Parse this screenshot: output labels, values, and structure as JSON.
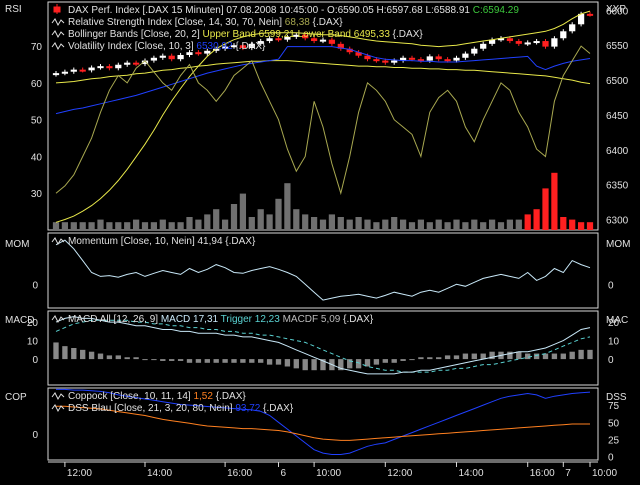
{
  "colors": {
    "background": "#000000",
    "frame": "#d8d8d8",
    "text": "#e0e0e0",
    "price_white": "#ffffff",
    "price_red": "#ff2020",
    "bollinger": "#e8e84a",
    "volatility": "#2040ff",
    "rsi": "#a8a850",
    "volume": "#707070",
    "momentum": "#c8e8f8",
    "macd": "#c8e8f8",
    "trigger": "#5ad2d2",
    "histogram": "#888888",
    "coppock": "#ff8020",
    "dss": "#2040ff",
    "last_price": "#3cc83c"
  },
  "chart_data": [
    {
      "type": "candlestick",
      "panel": "price",
      "left_label": "RSI",
      "right_label": "XXP",
      "left_axis_ticks": [
        30,
        40,
        50,
        60,
        70
      ],
      "right_axis_ticks": [
        6300,
        6350,
        6400,
        6450,
        6500,
        6550,
        6600
      ],
      "ylim_price": [
        6285,
        6612
      ],
      "ylim_rsi": [
        20,
        82
      ],
      "legend": [
        {
          "icon": "candle",
          "text": "DAX Perf. Index [.DAX  15 Minuten] 07.08.2008 10:45:00 - O:6590.05 H:6597.68 L:6588.91 ",
          "value": "C:6594.29",
          "value_color": "#3cc83c"
        },
        {
          "icon": "line",
          "text": "Relative Strength Index [Close, 14, 30, 70, Nein] ",
          "value": "68,38",
          "value_color": "#a8a850",
          "suffix": " {.DAX}"
        },
        {
          "icon": "line",
          "text": "Bollinger Bands [Close, 20, 2] ",
          "value": "Upper Band 6599,21 Lower Band 6495,33",
          "value_color": "#e8e84a",
          "suffix": " {.DAX}"
        },
        {
          "icon": "line",
          "text": "Volatility Index [Close, 10, 3] ",
          "value": "6530,92",
          "value_color": "#2040ff",
          "suffix": " {.DAX}"
        }
      ],
      "series": [
        {
          "name": "Close",
          "values": [
            6510,
            6512,
            6515,
            6514,
            6518,
            6520,
            6517,
            6522,
            6525,
            6523,
            6528,
            6532,
            6535,
            6530,
            6536,
            6540,
            6538,
            6542,
            6545,
            6548,
            6550,
            6546,
            6552,
            6556,
            6560,
            6558,
            6562,
            6565,
            6560,
            6556,
            6558,
            6552,
            6545,
            6540,
            6535,
            6530,
            6528,
            6525,
            6528,
            6532,
            6530,
            6528,
            6534,
            6530,
            6528,
            6532,
            6538,
            6545,
            6552,
            6558,
            6560,
            6556,
            6552,
            6554,
            6556,
            6548,
            6560,
            6570,
            6580,
            6595,
            6594
          ]
        },
        {
          "name": "Upper Band",
          "values": [
            6296,
            6300,
            6305,
            6312,
            6320,
            6330,
            6342,
            6356,
            6372,
            6390,
            6408,
            6428,
            6450,
            6470,
            6488,
            6505,
            6520,
            6534,
            6545,
            6552,
            6558,
            6562,
            6565,
            6567,
            6568,
            6568,
            6568,
            6568,
            6567,
            6566,
            6565,
            6565,
            6564,
            6562,
            6560,
            6558,
            6556,
            6555,
            6554,
            6553,
            6552,
            6550,
            6549,
            6548,
            6549,
            6550,
            6552,
            6554,
            6556,
            6558,
            6560,
            6562,
            6564,
            6566,
            6568,
            6570,
            6574,
            6580,
            6588,
            6595,
            6599
          ]
        },
        {
          "name": "Lower Band",
          "values": [
            6496,
            6497,
            6498,
            6500,
            6502,
            6503,
            6505,
            6506,
            6507,
            6509,
            6510,
            6512,
            6514,
            6515,
            6517,
            6518,
            6520,
            6521,
            6523,
            6524,
            6525,
            6526,
            6527,
            6527,
            6528,
            6528,
            6528,
            6527,
            6526,
            6525,
            6524,
            6523,
            6522,
            6521,
            6520,
            6520,
            6519,
            6519,
            6518,
            6518,
            6517,
            6517,
            6516,
            6516,
            6515,
            6515,
            6514,
            6514,
            6513,
            6512,
            6511,
            6510,
            6509,
            6508,
            6507,
            6506,
            6504,
            6502,
            6500,
            6497,
            6495
          ]
        },
        {
          "name": "Volatility Index",
          "values": [
            6452,
            6455,
            6458,
            6460,
            6463,
            6466,
            6469,
            6472,
            6475,
            6478,
            6482,
            6486,
            6490,
            6494,
            6498,
            6502,
            6506,
            6510,
            6513,
            6516,
            6519,
            6522,
            6524,
            6526,
            6528,
            6530,
            6548,
            6548,
            6548,
            6548,
            6548,
            6548,
            6546,
            6544,
            6540,
            6536,
            6532,
            6530,
            6529,
            6528,
            6528,
            6527,
            6527,
            6526,
            6526,
            6526,
            6527,
            6528,
            6529,
            6530,
            6531,
            6532,
            6533,
            6534,
            6520,
            6515,
            6520,
            6524,
            6527,
            6529,
            6531
          ]
        },
        {
          "name": "RSI",
          "values": [
            30,
            32,
            35,
            40,
            45,
            52,
            58,
            62,
            60,
            64,
            66,
            63,
            60,
            58,
            62,
            65,
            60,
            58,
            55,
            58,
            62,
            64,
            66,
            60,
            55,
            50,
            42,
            36,
            40,
            55,
            48,
            38,
            30,
            40,
            52,
            60,
            58,
            55,
            50,
            48,
            46,
            40,
            52,
            56,
            58,
            55,
            48,
            44,
            50,
            55,
            60,
            58,
            52,
            48,
            42,
            40,
            55,
            62,
            66,
            70,
            68
          ]
        },
        {
          "name": "Volume",
          "values": [
            3,
            3,
            3,
            3,
            3,
            4,
            3,
            3,
            3,
            4,
            3,
            3,
            4,
            3,
            3,
            5,
            4,
            6,
            8,
            4,
            10,
            14,
            5,
            8,
            6,
            12,
            18,
            8,
            6,
            5,
            4,
            6,
            5,
            4,
            5,
            4,
            3,
            4,
            5,
            4,
            3,
            4,
            3,
            4,
            3,
            4,
            3,
            4,
            3,
            4,
            3,
            4,
            4,
            6,
            8,
            16,
            22,
            5,
            4,
            3,
            3
          ]
        }
      ]
    },
    {
      "type": "line",
      "panel": "momentum",
      "left_label": "MOM",
      "right_label": "MOM",
      "axis_ticks": [
        0
      ],
      "ylim": [
        -60,
        130
      ],
      "legend": [
        {
          "icon": "line",
          "text": "Momentum [Close, 10, Nein] 41,94 {.DAX}"
        }
      ],
      "series": [
        {
          "name": "Momentum",
          "values": [
            100,
            112,
            90,
            60,
            30,
            20,
            22,
            18,
            25,
            30,
            20,
            28,
            35,
            30,
            25,
            40,
            30,
            38,
            50,
            42,
            30,
            28,
            35,
            40,
            45,
            38,
            30,
            20,
            0,
            -20,
            -40,
            -35,
            -30,
            -28,
            -25,
            -30,
            -35,
            -28,
            -20,
            -25,
            -30,
            -20,
            -15,
            -20,
            -10,
            0,
            -5,
            5,
            15,
            20,
            25,
            20,
            15,
            30,
            10,
            20,
            40,
            30,
            60,
            50,
            42
          ]
        }
      ]
    },
    {
      "type": "line",
      "panel": "macd",
      "left_label": "MACD",
      "right_label": "MAC",
      "axis_ticks": [
        0,
        10,
        20
      ],
      "ylim": [
        -14,
        26
      ],
      "legend": [
        {
          "icon": "line",
          "text": "MACD All [12, 26, 9] ",
          "value": "MACD 17,31",
          "value_color": "#c8e8f8",
          "parts": [
            {
              "text": " Trigger 12,23",
              "color": "#5ad2d2"
            },
            {
              "text": " MACDF 5,09",
              "color": "#bbbbbb"
            }
          ],
          "suffix": " {.DAX}"
        }
      ],
      "series": [
        {
          "name": "MACD",
          "values": [
            20,
            22,
            23,
            22,
            22,
            21,
            20,
            20,
            19,
            18,
            18,
            17,
            16,
            16,
            15,
            15,
            14,
            14,
            14,
            13,
            13,
            12,
            12,
            11,
            10,
            9,
            7,
            5,
            3,
            1,
            -1,
            -3,
            -5,
            -6,
            -7,
            -8,
            -8,
            -8,
            -8,
            -7,
            -7,
            -6,
            -6,
            -5,
            -4,
            -3,
            -2,
            -1,
            0,
            1,
            2,
            3,
            4,
            4,
            5,
            6,
            8,
            10,
            13,
            16,
            17
          ]
        },
        {
          "name": "Trigger",
          "values": [
            15,
            17,
            19,
            20,
            21,
            21,
            21,
            21,
            21,
            20,
            20,
            19,
            19,
            18,
            18,
            17,
            17,
            16,
            16,
            15,
            15,
            14,
            14,
            13,
            13,
            12,
            11,
            10,
            9,
            7,
            5,
            3,
            1,
            -1,
            -2,
            -4,
            -5,
            -6,
            -6,
            -7,
            -7,
            -7,
            -7,
            -6,
            -6,
            -5,
            -5,
            -4,
            -3,
            -3,
            -2,
            -1,
            0,
            1,
            2,
            3,
            5,
            7,
            9,
            11,
            12
          ]
        },
        {
          "name": "MACDF",
          "values": [
            9,
            7,
            6,
            5,
            4,
            3,
            2,
            2,
            1,
            1,
            0,
            0,
            -1,
            -1,
            -1,
            -2,
            -2,
            -2,
            -2,
            -2,
            -2,
            -2,
            -2,
            -2,
            -3,
            -3,
            -4,
            -5,
            -6,
            -6,
            -6,
            -6,
            -6,
            -5,
            -5,
            -4,
            -3,
            -2,
            -2,
            -1,
            0,
            1,
            1,
            1,
            2,
            2,
            3,
            3,
            3,
            4,
            4,
            4,
            4,
            3,
            3,
            3,
            3,
            3,
            4,
            5,
            5
          ]
        }
      ]
    },
    {
      "type": "line",
      "panel": "coppock",
      "left_label": "COP",
      "right_label": "DSS",
      "left_axis_ticks": [
        0
      ],
      "right_axis_ticks": [
        0,
        25,
        50,
        75
      ],
      "ylim_left": [
        -4,
        7
      ],
      "ylim_right": [
        -5,
        100
      ],
      "legend": [
        {
          "icon": "line",
          "text": "Coppock [Close, 10, 11, 14] ",
          "value": "1,52",
          "value_color": "#ff8020",
          "suffix": " {.DAX}"
        },
        {
          "icon": "line",
          "text": "DSS Blau [Close, 21, 3, 20, 80, Nein] ",
          "value": "93,72",
          "value_color": "#2040ff",
          "suffix": " {.DAX}"
        }
      ],
      "series": [
        {
          "name": "Coppock",
          "values": [
            4.2,
            4.2,
            4.1,
            4.0,
            3.9,
            3.8,
            3.6,
            3.4,
            3.2,
            3.0,
            2.8,
            2.5,
            2.2,
            2.0,
            1.8,
            1.6,
            1.4,
            1.2,
            1.1,
            1.0,
            0.9,
            0.8,
            0.8,
            0.7,
            0.6,
            0.5,
            0.3,
            0.0,
            -0.3,
            -0.6,
            -0.8,
            -0.9,
            -1.0,
            -1.0,
            -0.9,
            -0.8,
            -0.7,
            -0.6,
            -0.5,
            -0.4,
            -0.3,
            -0.2,
            -0.1,
            0.0,
            0.1,
            0.2,
            0.3,
            0.4,
            0.5,
            0.6,
            0.7,
            0.8,
            0.9,
            1.0,
            1.1,
            1.2,
            1.3,
            1.4,
            1.5,
            1.5,
            1.5
          ]
        },
        {
          "name": "DSS Blau",
          "values": [
            98,
            98,
            97,
            97,
            96,
            95,
            93,
            90,
            88,
            86,
            84,
            82,
            80,
            78,
            76,
            75,
            74,
            73,
            72,
            71,
            70,
            69,
            68,
            66,
            60,
            50,
            40,
            30,
            20,
            10,
            5,
            3,
            3,
            5,
            10,
            15,
            18,
            20,
            25,
            30,
            35,
            40,
            45,
            50,
            55,
            60,
            65,
            70,
            75,
            80,
            85,
            88,
            90,
            92,
            90,
            85,
            88,
            90,
            92,
            93,
            94
          ]
        }
      ]
    }
  ],
  "x_axis": {
    "ticks": [
      {
        "label": "12:00",
        "idx": 1
      },
      {
        "label": "14:00",
        "idx": 10
      },
      {
        "label": "16:00",
        "idx": 19
      },
      {
        "label": "6",
        "idx": 25
      },
      {
        "label": "10:00",
        "idx": 29
      },
      {
        "label": "12:00",
        "idx": 37
      },
      {
        "label": "14:00",
        "idx": 45
      },
      {
        "label": "16:00",
        "idx": 53
      },
      {
        "label": "7",
        "idx": 57
      },
      {
        "label": "10:00",
        "idx": 60
      }
    ]
  }
}
